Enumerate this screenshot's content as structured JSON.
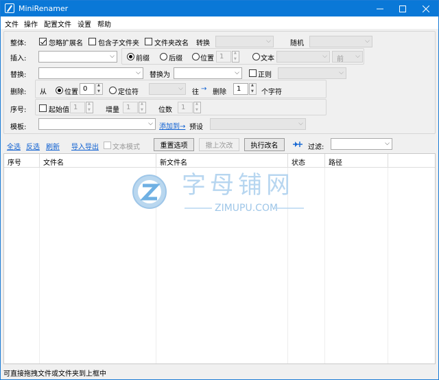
{
  "window": {
    "title": "MiniRenamer"
  },
  "menu": [
    "文件",
    "操作",
    "配置文件",
    "设置",
    "帮助"
  ],
  "operation": {
    "label": "整体:",
    "ignore_ext": "忽略扩展名",
    "include_sub": "包含子文件夹",
    "folder_rename": "文件夹改名",
    "convert_label": "转换",
    "random_label": "随机"
  },
  "insert": {
    "label": "插入:",
    "prefix": "前缀",
    "suffix": "后缀",
    "position": "位置",
    "position_value": "1",
    "text": "文本",
    "before_option": "前"
  },
  "replace": {
    "label": "替换:",
    "replace_with": "替换为",
    "regex": "正则"
  },
  "delete": {
    "label": "删除:",
    "from": "从",
    "position": "位置",
    "position_value": "0",
    "locator": "定位符",
    "to": "往",
    "arrow": "→",
    "delete_word": "删除",
    "count_value": "1",
    "chars": "个字符"
  },
  "serial": {
    "label": "序号:",
    "start_label": "起始值",
    "start_value": "1",
    "increment_label": "增量",
    "increment_value": "1",
    "digits_label": "位数",
    "digits_value": "1"
  },
  "template": {
    "label": "模板:",
    "add_to": "添加到→",
    "preset": "预设"
  },
  "toolbar": {
    "select_all": "全选",
    "invert": "反选",
    "refresh": "刷新",
    "import_export": "导入导出",
    "text_mode": "文本模式",
    "reset": "重置选项",
    "undo": "撤上次改",
    "execute": "执行改名",
    "filter": "过滤:"
  },
  "columns": [
    "序号",
    "文件名",
    "新文件名",
    "状态",
    "路径"
  ],
  "watermark": {
    "brand": "字母铺网",
    "domain": "ZIMUPU.COM"
  },
  "status": {
    "text": "可直接拖拽文件或文件夹到上框中"
  }
}
